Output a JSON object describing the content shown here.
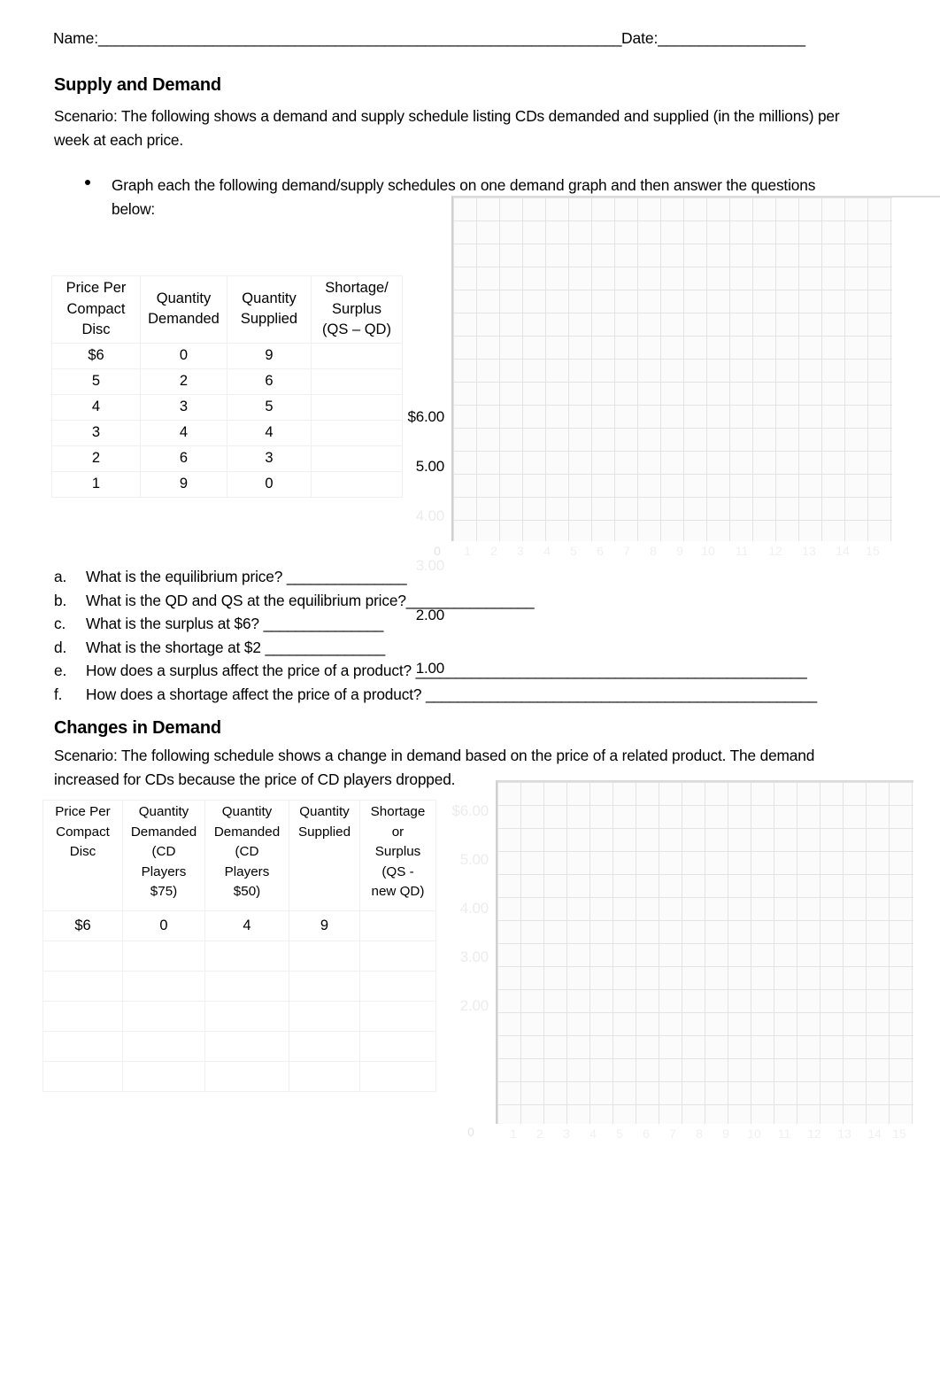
{
  "header": {
    "name_label": "Name:",
    "name_blank": "________________________________________________________________",
    "date_label": "Date:",
    "date_blank": "__________________"
  },
  "section_supply_demand": {
    "heading": "Supply and Demand",
    "scenario": "Scenario: The following shows a demand and supply schedule listing CDs demanded and supplied (in the millions) per week at each price.",
    "bullet": "Graph each the following demand/supply schedules on one demand graph and then answer the questions below:",
    "table": {
      "headers": [
        "Price Per Compact Disc",
        "Quantity Demanded",
        "Quantity Supplied",
        "Shortage/ Surplus (QS – QD)"
      ],
      "header_lines": [
        [
          "Price Per",
          "Compact",
          "Disc"
        ],
        [
          "Quantity",
          "Demanded"
        ],
        [
          "Quantity",
          "Supplied"
        ],
        [
          "Shortage/",
          "Surplus",
          "(QS – QD)"
        ]
      ],
      "rows": [
        [
          "$6",
          "0",
          "9",
          ""
        ],
        [
          "5",
          "2",
          "6",
          ""
        ],
        [
          "4",
          "3",
          "5",
          ""
        ],
        [
          "3",
          "4",
          "4",
          ""
        ],
        [
          "2",
          "6",
          "3",
          ""
        ],
        [
          "1",
          "9",
          "0",
          ""
        ]
      ]
    },
    "questions": [
      {
        "label": "a.",
        "text": "What is the equilibrium price? ",
        "blank": "_______________"
      },
      {
        "label": "b.",
        "text": "What is the QD and QS at the equilibrium price?",
        "blank": "________________"
      },
      {
        "label": "c.",
        "text": "What is the surplus at $6? ",
        "blank": "_______________"
      },
      {
        "label": "d.",
        "text": "What is the shortage at $2 ",
        "blank": "_______________"
      },
      {
        "label": "e.",
        "text": "How does a surplus affect the price of a product? ",
        "blank": "_________________________________________________"
      },
      {
        "label": "f.",
        "text": "How does a shortage affect the price of a product? ",
        "blank": "_________________________________________________"
      }
    ]
  },
  "section_changes_demand": {
    "heading": "Changes in Demand",
    "scenario": "Scenario: The following schedule shows a change in demand based on the price of a related product. The demand increased for CDs because the price of CD players dropped.",
    "table": {
      "headers": [
        "Price Per Compact Disc",
        "Quantity Demanded (CD Players $75)",
        "Quantity Demanded (CD Players $50)",
        "Quantity Supplied",
        "Shortage or Surplus (QS - new QD)"
      ],
      "header_lines": [
        [
          "Price Per",
          "Compact",
          "Disc"
        ],
        [
          "Quantity",
          "Demanded",
          "(CD",
          "Players",
          "$75)"
        ],
        [
          "Quantity",
          "Demanded",
          "(CD",
          "Players",
          "$50)"
        ],
        [
          "Quantity",
          "Supplied"
        ],
        [
          "Shortage",
          "or",
          "Surplus",
          "(QS -",
          "new QD)"
        ]
      ],
      "rows": [
        [
          "$6",
          "0",
          "4",
          "9",
          ""
        ],
        [
          "",
          "",
          "",
          "",
          ""
        ],
        [
          "",
          "",
          "",
          "",
          ""
        ],
        [
          "",
          "",
          "",
          "",
          ""
        ],
        [
          "",
          "",
          "",
          "",
          ""
        ],
        [
          "",
          "",
          "",
          "",
          ""
        ]
      ]
    }
  },
  "chart_data": [
    {
      "name": "supply-demand-grid",
      "type": "line",
      "title": "",
      "xlabel": "",
      "ylabel": "",
      "grid": true,
      "legend": "none",
      "series": [],
      "ylim": [
        0,
        6.5
      ],
      "xlim": [
        0,
        15
      ],
      "ytick_labels": [
        "$6.00",
        "5.00",
        "4.00",
        "3.00",
        "2.00",
        "1.00"
      ],
      "ytick_values": [
        6,
        5,
        4,
        3,
        2,
        1
      ],
      "ytick_visible": [
        true,
        true,
        false,
        false,
        true,
        true
      ],
      "xtick_labels": [
        "0",
        "1",
        "2",
        "3",
        "4",
        "5",
        "6",
        "7",
        "8",
        "9",
        "10",
        "11",
        "12",
        "13",
        "14",
        "15"
      ]
    },
    {
      "name": "changes-in-demand-grid",
      "type": "line",
      "title": "",
      "xlabel": "",
      "ylabel": "",
      "grid": true,
      "legend": "none",
      "series": [],
      "ylim": [
        0,
        6.5
      ],
      "xlim": [
        0,
        15
      ],
      "ytick_labels": [
        "$6.00",
        "5.00",
        "4.00",
        "3.00",
        "2.00"
      ],
      "ytick_values": [
        6,
        5,
        4,
        3,
        2
      ],
      "ytick_visible": [
        false,
        false,
        false,
        false,
        false
      ],
      "xtick_labels": [
        "0",
        "1",
        "2",
        "3",
        "4",
        "5",
        "6",
        "7",
        "8",
        "9",
        "10",
        "11",
        "12",
        "13",
        "14",
        "15"
      ]
    }
  ]
}
